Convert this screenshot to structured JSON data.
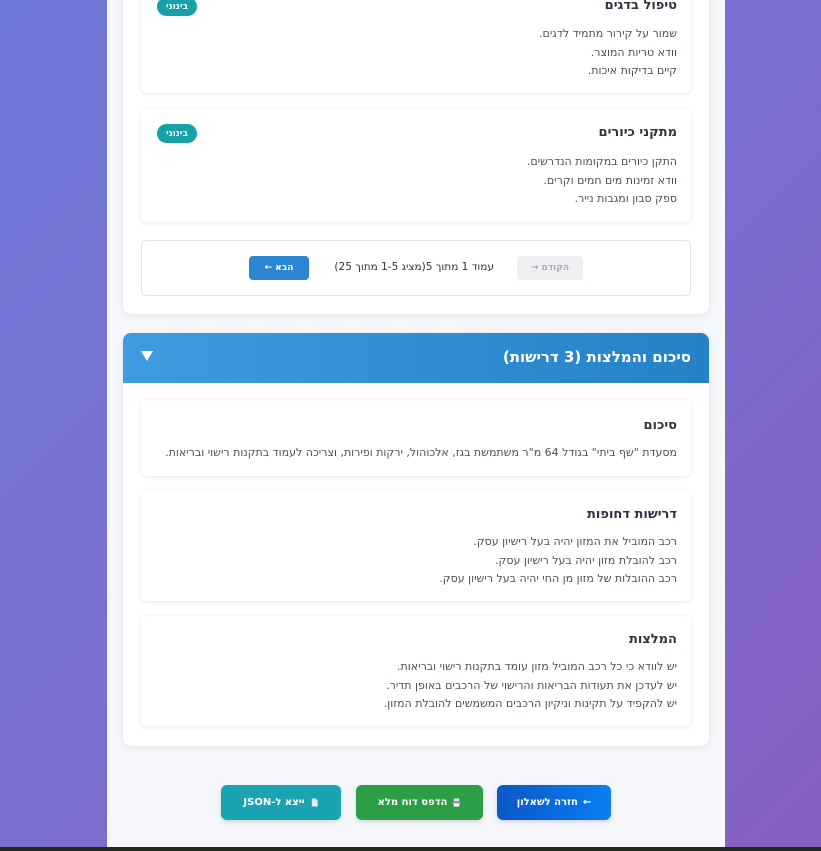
{
  "top_cards": [
    {
      "title": "טיפול בדגים",
      "badge": "בינוני",
      "lines": [
        "שמור על קירור מתמיד לדגים.",
        "וודא טריות המוצר.",
        "קיים בדיקות איכות."
      ]
    },
    {
      "title": "מתקני כיורים",
      "badge": "בינוני",
      "lines": [
        "התקן כיורים במקומות הנדרשים.",
        "וודא זמינות מים חמים וקרים.",
        "ספק סבון ומגבות נייר."
      ]
    }
  ],
  "pagination": {
    "prev_label": "הקודם",
    "next_label": "הבא",
    "info": "עמוד 1 מתוך 5(מציג 1-5 מתוך 25)"
  },
  "summary_section": {
    "title": "סיכום והמלצות (3 דרישות)",
    "cards": [
      {
        "title": "סיכום",
        "lines": [
          "מסעדת \"שף ביתי\" בגודל 64 מ\"ר משתמשת בגז, אלכוהול, ירקות ופירות, וצריכה לעמוד בתקנות רישוי ובריאות."
        ]
      },
      {
        "title": "דרישות דחופות",
        "lines": [
          "רכב המוביל את המזון יהיה בעל רישיון עסק.",
          "רכב להובלת מזון יהיה בעל רישיון עסק.",
          "רכב ההובלות של מזון מן החי יהיה בעל רישיון עסק."
        ]
      },
      {
        "title": "המלצות",
        "lines": [
          "יש לוודא כי כל רכב המוביל מזון עומד בתקנות רישוי ובריאות.",
          "יש לעדכן את תעודות הבריאות והרישוי של הרכבים באופן תדיר.",
          "יש להקפיד על תקינות וניקיון הרכבים המשמשים להובלת המזון."
        ]
      }
    ]
  },
  "actions": {
    "back_label": "חזרה לשאלון",
    "print_label": "הדפס דוח מלא",
    "json_label": "ייצא ל-JSON"
  },
  "colors": {
    "badge": "#17a0a8",
    "header": "#2582c8",
    "back": "#0a6ee0",
    "print": "#2b9e46",
    "json": "#1aa3b0"
  }
}
